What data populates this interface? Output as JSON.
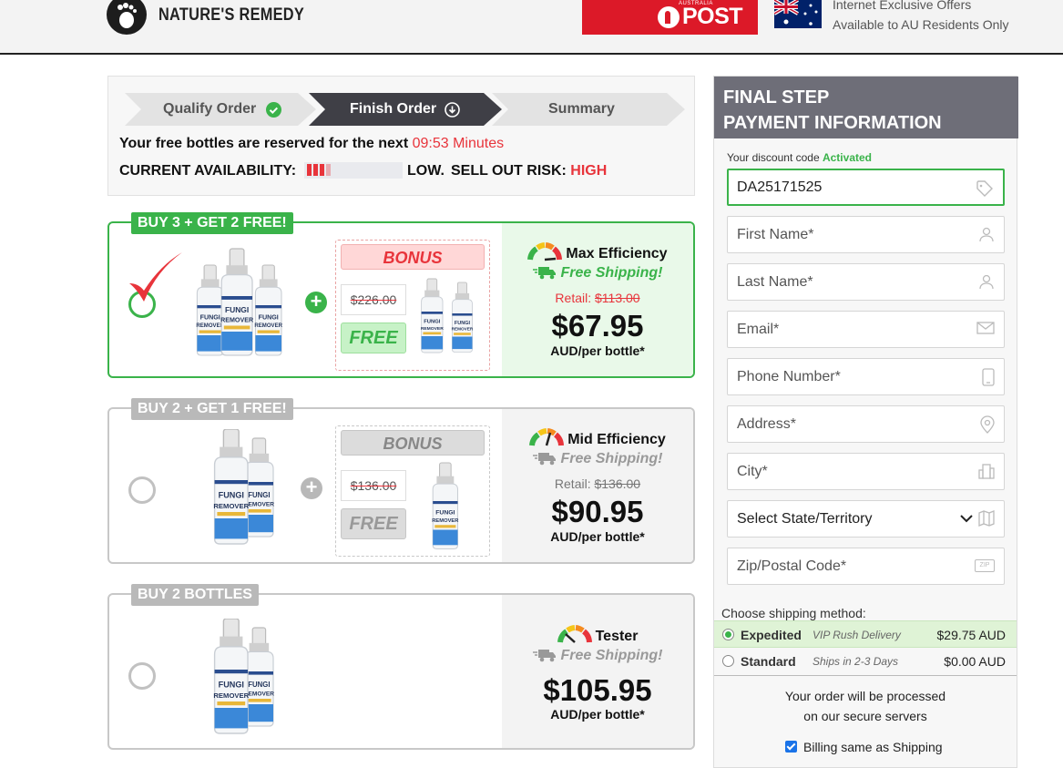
{
  "header": {
    "brand": "NATURE'S REMEDY",
    "post_small": "AUSTRALIA",
    "post_big": "POST",
    "offer_line1": "Internet Exclusive Offers",
    "offer_line2": "Available to AU Residents Only"
  },
  "progress": {
    "steps": [
      {
        "label": "Qualify Order",
        "state": "done"
      },
      {
        "label": "Finish Order",
        "state": "active"
      },
      {
        "label": "Summary",
        "state": "pending"
      }
    ],
    "reserve_text": "Your free bottles are reserved for the next ",
    "timer": "09:53 Minutes",
    "availability_label": "CURRENT AVAILABILITY:",
    "availability_level": 0.3,
    "low": "LOW.",
    "risk_label": "SELL OUT RISK:",
    "risk_value": "HIGH"
  },
  "packages": [
    {
      "tag": "BUY 3 + GET 2 FREE!",
      "selected": true,
      "bonus": "BONUS",
      "old_price": "$226.00",
      "free": "FREE",
      "efficiency": "Max Efficiency",
      "shipping": "Free Shipping!",
      "retail_label": "Retail: ",
      "retail_price": "$113.00",
      "price": "$67.95",
      "per": "AUD/per bottle*"
    },
    {
      "tag": "BUY 2 + GET 1 FREE!",
      "selected": false,
      "bonus": "BONUS",
      "old_price": "$136.00",
      "free": "FREE",
      "efficiency": "Mid Efficiency",
      "shipping": "Free Shipping!",
      "retail_label": "Retail: ",
      "retail_price": "$136.00",
      "price": "$90.95",
      "per": "AUD/per bottle*"
    },
    {
      "tag": "BUY 2 BOTTLES",
      "selected": false,
      "efficiency": "Tester",
      "shipping": "Free Shipping!",
      "price": "$105.95",
      "per": "AUD/per bottle*"
    }
  ],
  "bottle_label": {
    "line1": "FUNGI",
    "line2": "REMOVER"
  },
  "form": {
    "title_line1": "FINAL STEP",
    "title_line2": "PAYMENT INFORMATION",
    "discount_label": "Your discount code ",
    "discount_status": "Activated",
    "discount_code": "DA25171525",
    "fields": {
      "first_name": "First Name*",
      "last_name": "Last Name*",
      "email": "Email*",
      "phone": "Phone Number*",
      "address": "Address*",
      "city": "City*",
      "state": "Select State/Territory",
      "zip": "Zip/Postal Code*"
    },
    "shipping_title": "Choose shipping method:",
    "shipping_options": [
      {
        "name": "Expedited",
        "desc": "VIP Rush Delivery",
        "price": "$29.75 AUD",
        "selected": true
      },
      {
        "name": "Standard",
        "desc": "Ships in 2-3 Days",
        "price": "$0.00 AUD",
        "selected": false
      }
    ],
    "secure_line1": "Your order will be processed",
    "secure_line2": "on our secure servers",
    "billing_label": "Billing same as Shipping",
    "zip_icon_text": "ZIP"
  },
  "colors": {
    "green": "#3ab34a",
    "red": "#e8343b",
    "panel_head": "#6e6e78",
    "post_red": "#dc1928"
  }
}
